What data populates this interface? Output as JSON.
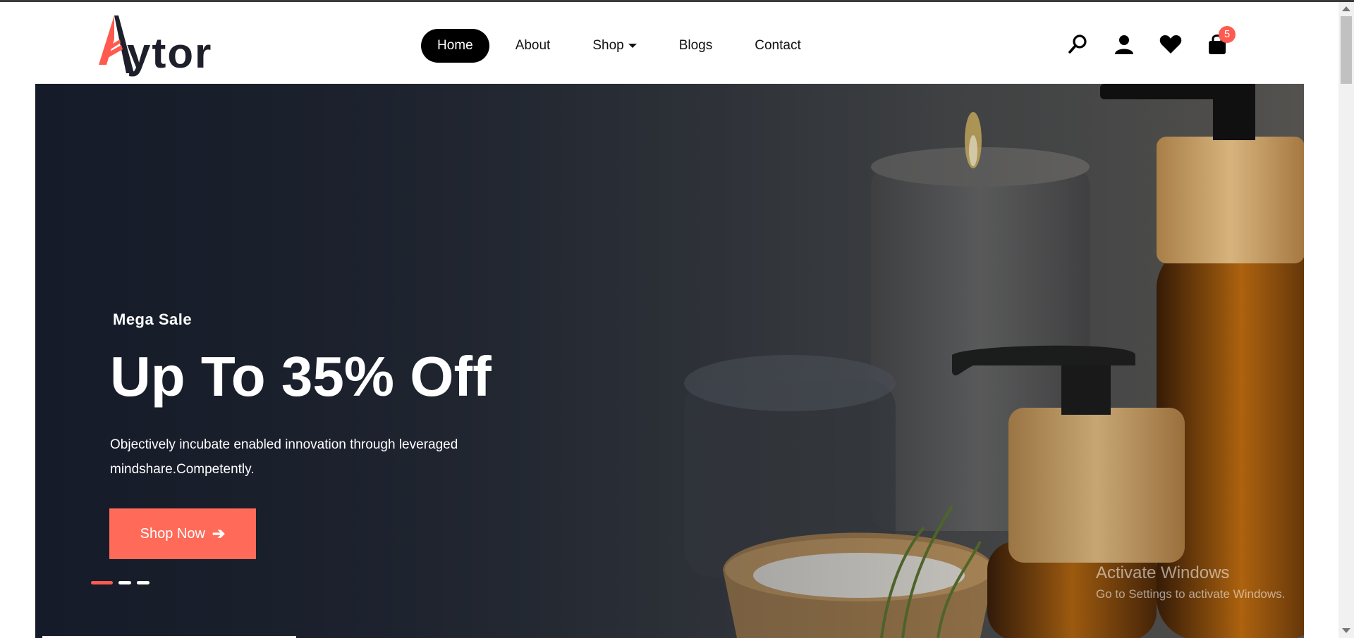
{
  "brand": {
    "name": "ytor",
    "accent_color": "#ff5a4f"
  },
  "nav": {
    "items": [
      {
        "label": "Home",
        "active": true
      },
      {
        "label": "About"
      },
      {
        "label": "Shop",
        "has_dropdown": true
      },
      {
        "label": "Blogs"
      },
      {
        "label": "Contact"
      }
    ]
  },
  "header_icons": {
    "search": "search-icon",
    "account": "user-icon",
    "wishlist": "heart-icon",
    "cart": "shopping-bag-icon",
    "cart_count": "5"
  },
  "hero": {
    "eyebrow": "Mega Sale",
    "headline": "Up To 35% Off",
    "description": "Objectively incubate enabled innovation through leveraged mindshare.Competently.",
    "cta_label": "Shop Now",
    "cta_icon": "arrow-right-icon",
    "cta_color": "#ff6a59",
    "slides_total": 3,
    "active_slide": 1
  },
  "os_watermark": {
    "title": "Activate Windows",
    "subtitle": "Go to Settings to activate Windows."
  }
}
